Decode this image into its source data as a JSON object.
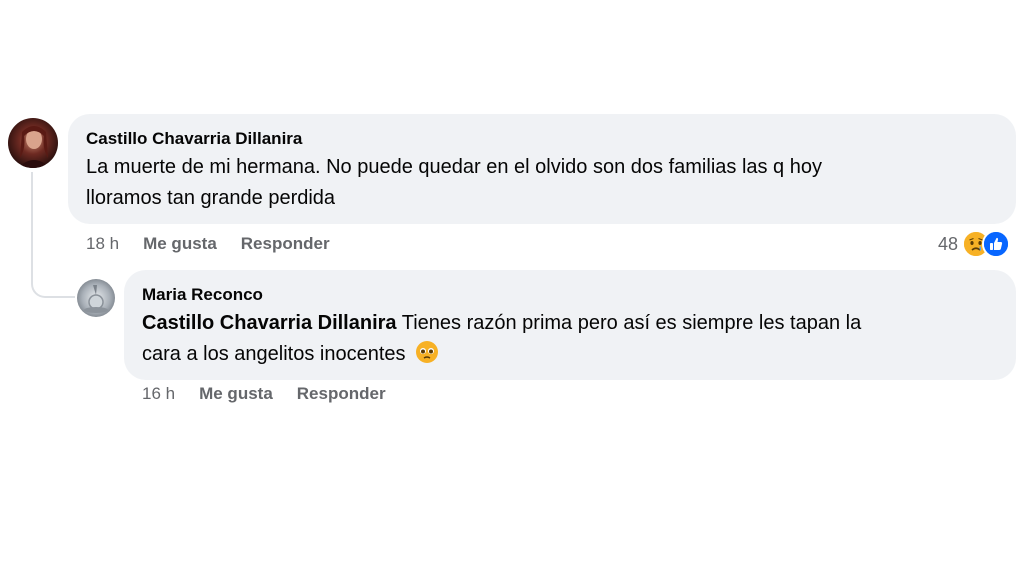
{
  "comment": {
    "author": "Castillo Chavarria Dillanira",
    "text_line1": "La muerte de mi hermana. No puede quedar en el olvido son dos familias las q hoy",
    "text_line2": "lloramos tan grande perdida",
    "time": "18 h",
    "like_label": "Me gusta",
    "reply_label": "Responder",
    "reaction_count": "48",
    "reaction_icons": [
      "sad-crying-icon",
      "like-thumb-icon"
    ]
  },
  "reply": {
    "author": "Maria Reconco",
    "mention": "Castillo Chavarria Dillanira",
    "text_line1": " Tienes razón prima pero así es siempre les tapan la",
    "text_line2": "cara a los angelitos inocentes",
    "emoji": "pleading-face-icon",
    "time": "16 h",
    "like_label": "Me gusta",
    "reply_label": "Responder"
  },
  "colors": {
    "bubble": "#f0f2f5",
    "meta_text": "#65676b",
    "like_blue": "#0866ff",
    "emoji_yellow": "#f7b125"
  }
}
